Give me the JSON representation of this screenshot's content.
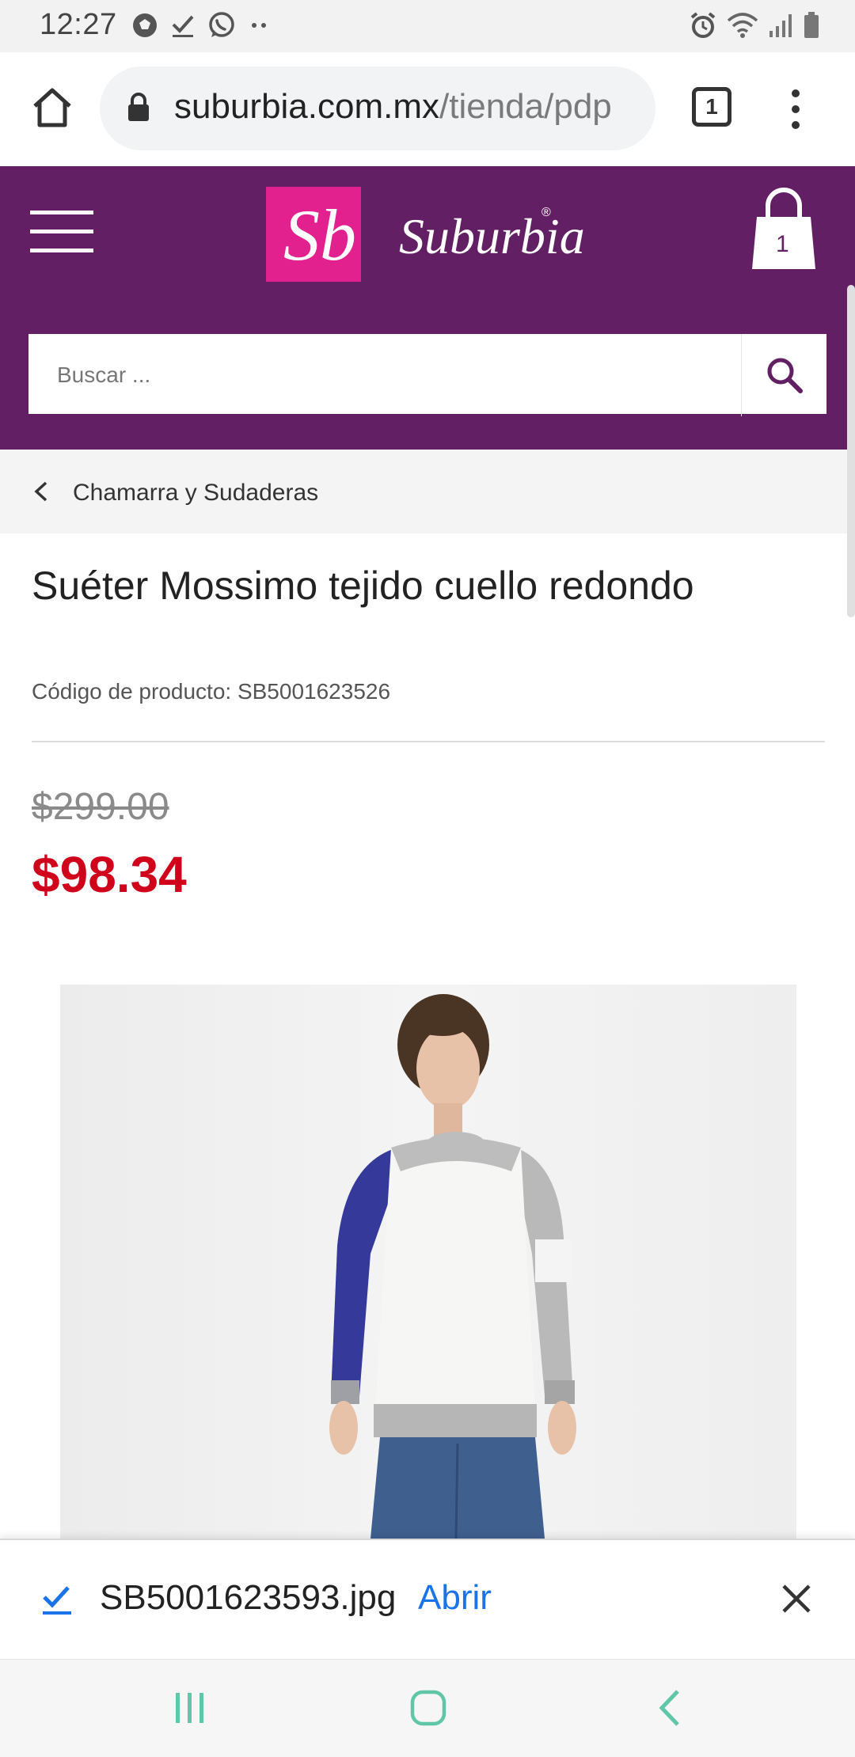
{
  "status_bar": {
    "time": "12:27",
    "left_icons": [
      "soccer-ball-icon",
      "checkmark-download-icon",
      "whatsapp-icon",
      "more-dots-icon"
    ],
    "right_icons": [
      "alarm-icon",
      "wifi-icon",
      "signal-icon",
      "battery-icon"
    ]
  },
  "browser": {
    "url_host": "suburbia.com.mx",
    "url_path": "/tienda/pdp",
    "tab_count": "1"
  },
  "header": {
    "logo_mark": "Sb",
    "brand_name": "Suburbia",
    "registered": "®",
    "cart_count": "1",
    "search_placeholder": "Buscar ...",
    "colors": {
      "brand_purple": "#631f64",
      "logo_pink": "#e2208e"
    }
  },
  "breadcrumb": {
    "label": "Chamarra y Sudaderas"
  },
  "product": {
    "title": "Suéter Mossimo tejido cuello redondo",
    "code_label": "Código de producto: SB5001623526",
    "old_price": "$299.00",
    "price": "$98.34",
    "colors": {
      "price_red": "#d0021b"
    }
  },
  "download": {
    "filename": "SB5001623593.jpg",
    "open_label": "Abrir"
  },
  "navbar": {
    "icons": [
      "recent-apps-icon",
      "home-icon",
      "back-icon"
    ]
  }
}
